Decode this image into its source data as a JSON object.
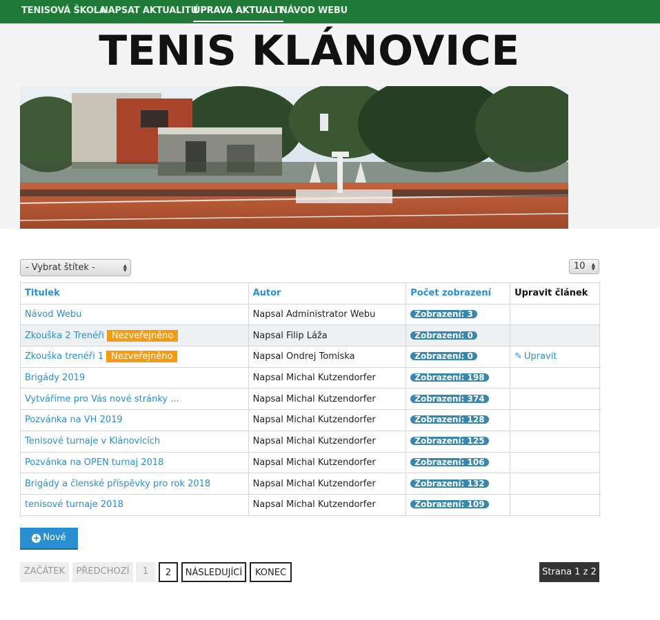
{
  "nav": {
    "items": [
      {
        "label": "Tenisová škola"
      },
      {
        "label": "Napsat aktualitu"
      },
      {
        "label": "Úprava aktualit"
      },
      {
        "label": "Návod webu"
      }
    ]
  },
  "header": {
    "site_title": "TENIS KLÁNOVICE"
  },
  "filters": {
    "tag_select": "- Vybrat štítek -",
    "per_page": "10"
  },
  "table": {
    "headers": [
      "Titulek",
      "Autor",
      "Počet zobrazení",
      "Upravit článek"
    ],
    "rows": [
      {
        "title": "Návod Webu",
        "badge": "",
        "author": "Napsal Administrator Webu",
        "views": "Zobrazení: 3",
        "edit": ""
      },
      {
        "title": "Zkouška 2 Trenéři",
        "badge": "Nezveřejněno",
        "author": "Napsal Filip Láža",
        "views": "Zobrazení: 0",
        "edit": ""
      },
      {
        "title": "Zkouška trenéři 1",
        "badge": "Nezveřejněno",
        "author": "Napsal Ondrej Tomiska",
        "views": "Zobrazení: 0",
        "edit": "Upravit"
      },
      {
        "title": "Brigády 2019",
        "badge": "",
        "author": "Napsal Michal Kutzendorfer",
        "views": "Zobrazení: 198",
        "edit": ""
      },
      {
        "title": "Vytváříme pro Vás nové stránky ...",
        "badge": "",
        "author": "Napsal Michal Kutzendorfer",
        "views": "Zobrazení: 374",
        "edit": ""
      },
      {
        "title": "Pozvánka na VH 2019",
        "badge": "",
        "author": "Napsal Michal Kutzendorfer",
        "views": "Zobrazení: 128",
        "edit": ""
      },
      {
        "title": "Tenisové turnaje v Klánovicích",
        "badge": "",
        "author": "Napsal Michal Kutzendorfer",
        "views": "Zobrazení: 125",
        "edit": ""
      },
      {
        "title": "Pozvánka na OPEN turnaj 2018",
        "badge": "",
        "author": "Napsal Michal Kutzendorfer",
        "views": "Zobrazení: 106",
        "edit": ""
      },
      {
        "title": "Brigády a členské příspěvky pro rok 2018",
        "badge": "",
        "author": "Napsal Michal Kutzendorfer",
        "views": "Zobrazení: 132",
        "edit": ""
      },
      {
        "title": "tenisové turnaje 2018",
        "badge": "",
        "author": "Napsal Michal Kutzendorfer",
        "views": "Zobrazení: 109",
        "edit": ""
      }
    ]
  },
  "actions": {
    "new_label": "Nové"
  },
  "pagination": {
    "first": "Začátek",
    "prev": "Předchozí",
    "page1": "1",
    "page2": "2",
    "next": "Následující",
    "last": "Konec",
    "info": "Strana 1 z 2"
  },
  "colors": {
    "nav_bg": "#1f7a37",
    "link": "#2a8fd1",
    "badge_unpublished": "#f39c12",
    "views_badge": "#3a87ad"
  }
}
